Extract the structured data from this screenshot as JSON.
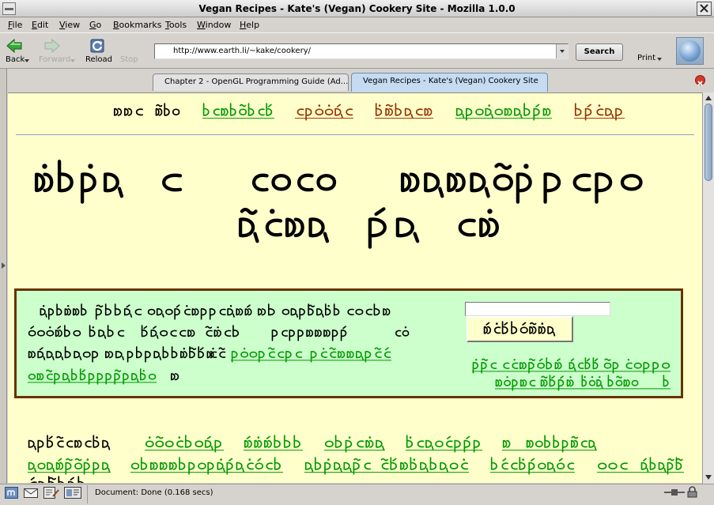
{
  "window": {
    "title": "Vegan Recipes - Kate's (Vegan) Cookery Site - Mozilla 1.0.0"
  },
  "menu": [
    "File",
    "Edit",
    "View",
    "Go",
    "Bookmarks",
    "Tools",
    "Window",
    "Help"
  ],
  "toolbar": {
    "back": "Back",
    "forward": "Forward",
    "reload": "Reload",
    "stop": "Stop",
    "url": "http://www.earth.li/~kake/cookery/",
    "search": "Search",
    "print": "Print"
  },
  "toolbar_state": {
    "forward_enabled": false,
    "stop_enabled": false
  },
  "tabs": [
    {
      "title": "Chapter 2 - OpenGL Programming Guide (Ad...",
      "active": false
    },
    {
      "title": "Vegan Recipes - Kate's (Vegan) Cookery Site",
      "active": true
    }
  ],
  "status": {
    "text": "Document: Done (0.168 secs)"
  },
  "icons": {
    "window_menu": "window-menu-icon",
    "close_window": "close-window-icon",
    "back": "back-arrow-icon",
    "forward": "forward-arrow-icon",
    "reload": "reload-icon",
    "throbber": "mozilla-throbber-icon",
    "close_tab": "close-tab-icon",
    "status_navigator": "navigator-icon",
    "status_mail": "mail-icon",
    "status_composer": "composer-icon",
    "status_addressbook": "address-book-icon",
    "status_online": "online-connection-icon",
    "status_security": "security-lock-icon"
  },
  "colors": {
    "page_bg": "#ffffcc",
    "text": "#000000",
    "link": "#009900",
    "visited_link": "#993300",
    "box_bg": "#ccffcc",
    "box_border": "#663300"
  }
}
